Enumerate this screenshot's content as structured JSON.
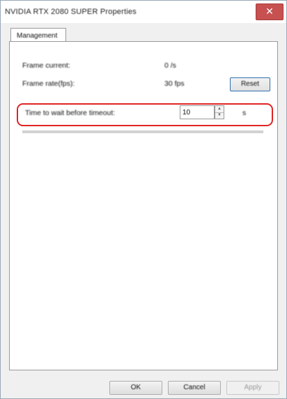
{
  "window": {
    "title": "NVIDIA RTX 2080 SUPER Properties",
    "close_label": "✕"
  },
  "tabs": [
    {
      "label": "Management"
    }
  ],
  "rows": [
    {
      "label": "Frame current:",
      "value": "0 /s"
    },
    {
      "label": "Frame rate(fps):",
      "value": "30 fps"
    }
  ],
  "reset_label": "Reset",
  "setting": {
    "label": "Time to wait before timeout:",
    "value": "10",
    "unit": "s"
  },
  "buttons": {
    "ok": "OK",
    "cancel": "Cancel",
    "apply": "Apply"
  }
}
